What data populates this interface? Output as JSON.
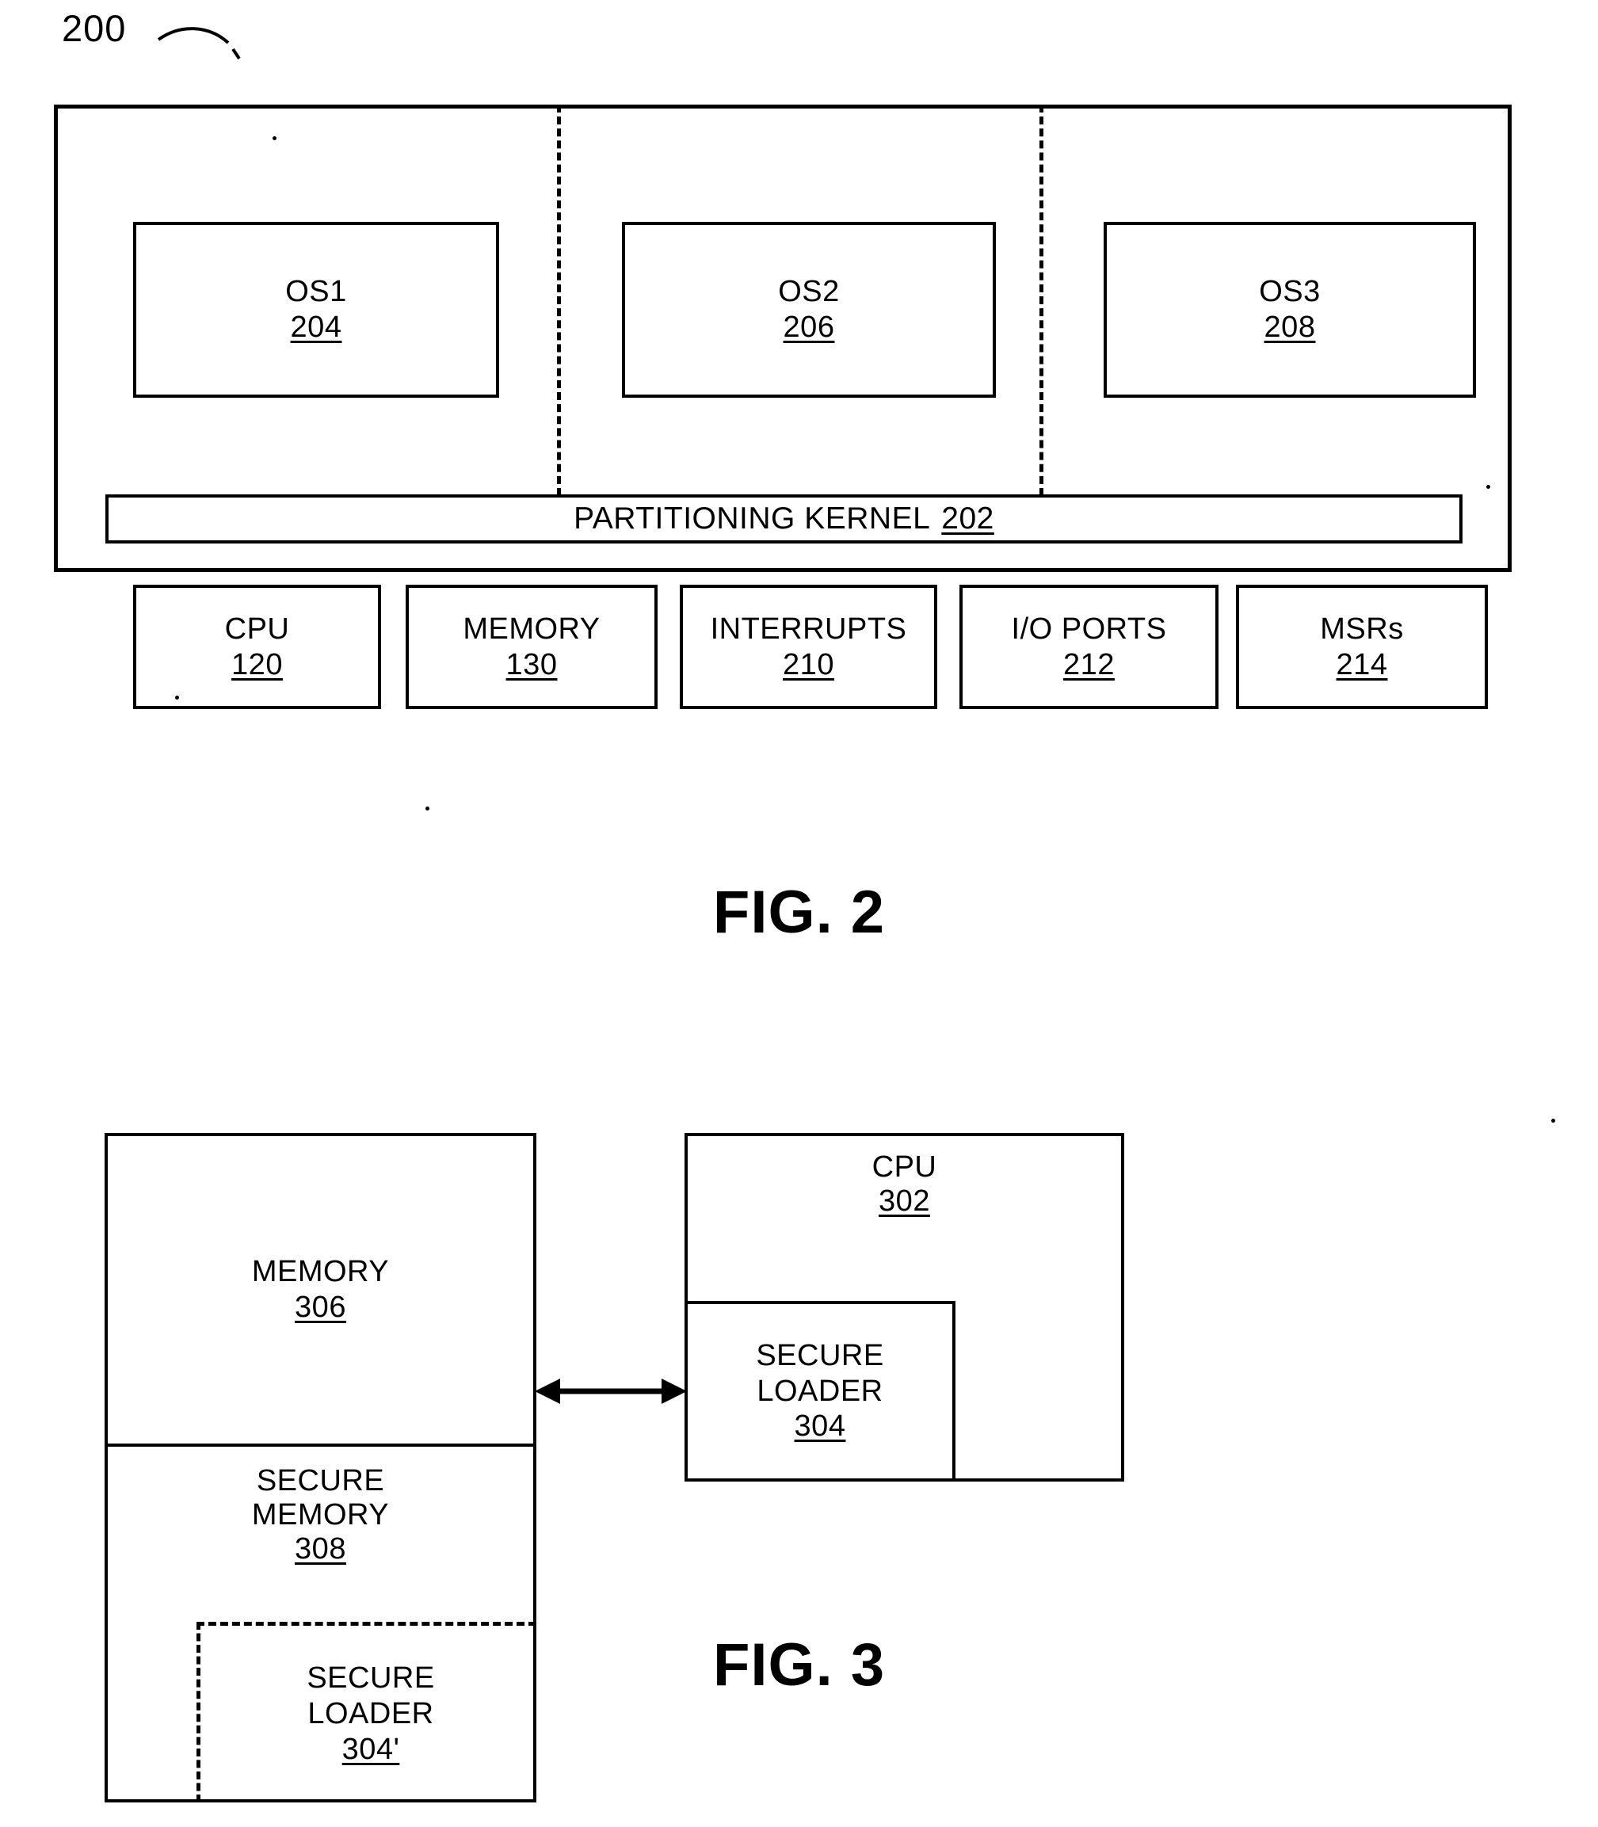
{
  "page": {
    "figure_number_callout": "200"
  },
  "fig2": {
    "caption": "FIG. 2",
    "os_boxes": [
      {
        "label": "OS1",
        "ref": "204"
      },
      {
        "label": "OS2",
        "ref": "206"
      },
      {
        "label": "OS3",
        "ref": "208"
      }
    ],
    "kernel": {
      "label": "PARTITIONING KERNEL",
      "ref": "202"
    },
    "resources": [
      {
        "label": "CPU",
        "ref": "120"
      },
      {
        "label": "MEMORY",
        "ref": "130"
      },
      {
        "label": "INTERRUPTS",
        "ref": "210"
      },
      {
        "label": "I/O PORTS",
        "ref": "212"
      },
      {
        "label": "MSRs",
        "ref": "214"
      }
    ]
  },
  "fig3": {
    "caption": "FIG. 3",
    "memory": {
      "label": "MEMORY",
      "ref": "306"
    },
    "secure_memory": {
      "label_line1": "SECURE",
      "label_line2": "MEMORY",
      "ref": "308"
    },
    "secure_loader_in_memory": {
      "label_line1": "SECURE",
      "label_line2": "LOADER",
      "ref": "304'"
    },
    "cpu": {
      "label": "CPU",
      "ref": "302"
    },
    "secure_loader_in_cpu": {
      "label_line1": "SECURE",
      "label_line2": "LOADER",
      "ref": "304"
    },
    "connector": "bidirectional-arrow"
  },
  "colors": {
    "ink": "#000000",
    "paper": "#ffffff"
  }
}
